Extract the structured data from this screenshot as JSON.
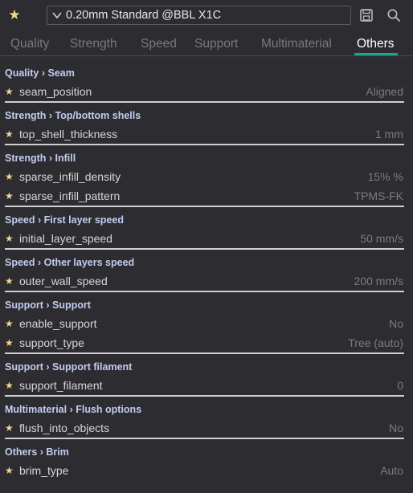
{
  "toolbar": {
    "star_icon": "star-icon",
    "preset_name": "0.20mm Standard @BBL X1C",
    "save_icon": "save-icon",
    "search_icon": "search-icon"
  },
  "tabs": [
    {
      "label": "Quality"
    },
    {
      "label": "Strength"
    },
    {
      "label": "Speed"
    },
    {
      "label": "Support"
    },
    {
      "label": "Multimaterial"
    },
    {
      "label": "Others",
      "active": true
    }
  ],
  "colors": {
    "accent": "#17a88c",
    "star": "#f0d58a",
    "group_title": "#c3ccf0",
    "background": "#2d2d31"
  },
  "groups": [
    {
      "title": "Quality › Seam",
      "options": [
        {
          "name": "seam_position",
          "value": "Aligned"
        }
      ]
    },
    {
      "title": "Strength › Top/bottom shells",
      "options": [
        {
          "name": "top_shell_thickness",
          "value": "1 mm"
        }
      ]
    },
    {
      "title": "Strength › Infill",
      "options": [
        {
          "name": "sparse_infill_density",
          "value": "15% %"
        },
        {
          "name": "sparse_infill_pattern",
          "value": "TPMS-FK"
        }
      ]
    },
    {
      "title": "Speed › First layer speed",
      "options": [
        {
          "name": "initial_layer_speed",
          "value": "50 mm/s"
        }
      ]
    },
    {
      "title": "Speed › Other layers speed",
      "options": [
        {
          "name": "outer_wall_speed",
          "value": "200 mm/s"
        }
      ]
    },
    {
      "title": "Support › Support",
      "options": [
        {
          "name": "enable_support",
          "value": "No"
        },
        {
          "name": "support_type",
          "value": "Tree (auto)"
        }
      ]
    },
    {
      "title": "Support › Support filament",
      "options": [
        {
          "name": "support_filament",
          "value": "0"
        }
      ]
    },
    {
      "title": "Multimaterial › Flush options",
      "options": [
        {
          "name": "flush_into_objects",
          "value": "No"
        }
      ]
    },
    {
      "title": "Others › Brim",
      "options": [
        {
          "name": "brim_type",
          "value": "Auto"
        }
      ]
    }
  ]
}
